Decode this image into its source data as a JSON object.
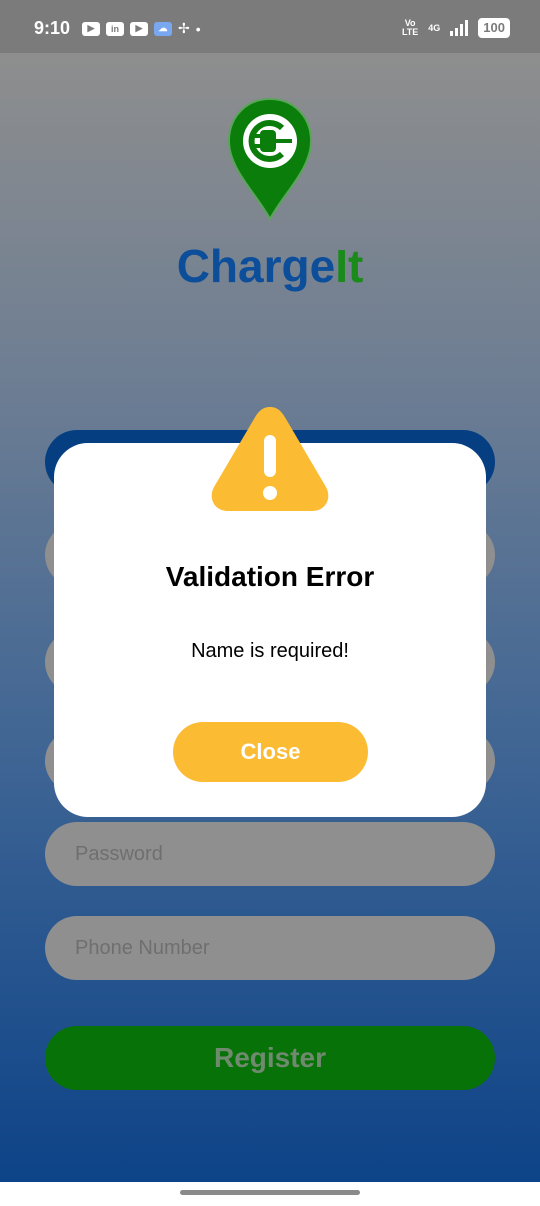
{
  "status_bar": {
    "time": "9:10",
    "notification_icons": [
      "youtube-icon",
      "linkedin-icon",
      "youtube-icon",
      "weather-icon",
      "fan-icon",
      "dot-icon"
    ],
    "volte_top": "Vo",
    "volte_bottom": "LTE",
    "network": "4G",
    "battery": "100"
  },
  "app": {
    "title_part1": "Charge",
    "title_part2": "It",
    "colors": {
      "brand_blue": "#0c4e9a",
      "brand_green": "#1a8a1a",
      "register_green": "#077207",
      "accent_yellow": "#fbbc33"
    }
  },
  "form": {
    "password_placeholder": "Password",
    "phone_placeholder": "Phone Number",
    "register_label": "Register"
  },
  "dialog": {
    "title": "Validation Error",
    "message": "Name is required!",
    "close_label": "Close",
    "icon": "warning-icon"
  }
}
